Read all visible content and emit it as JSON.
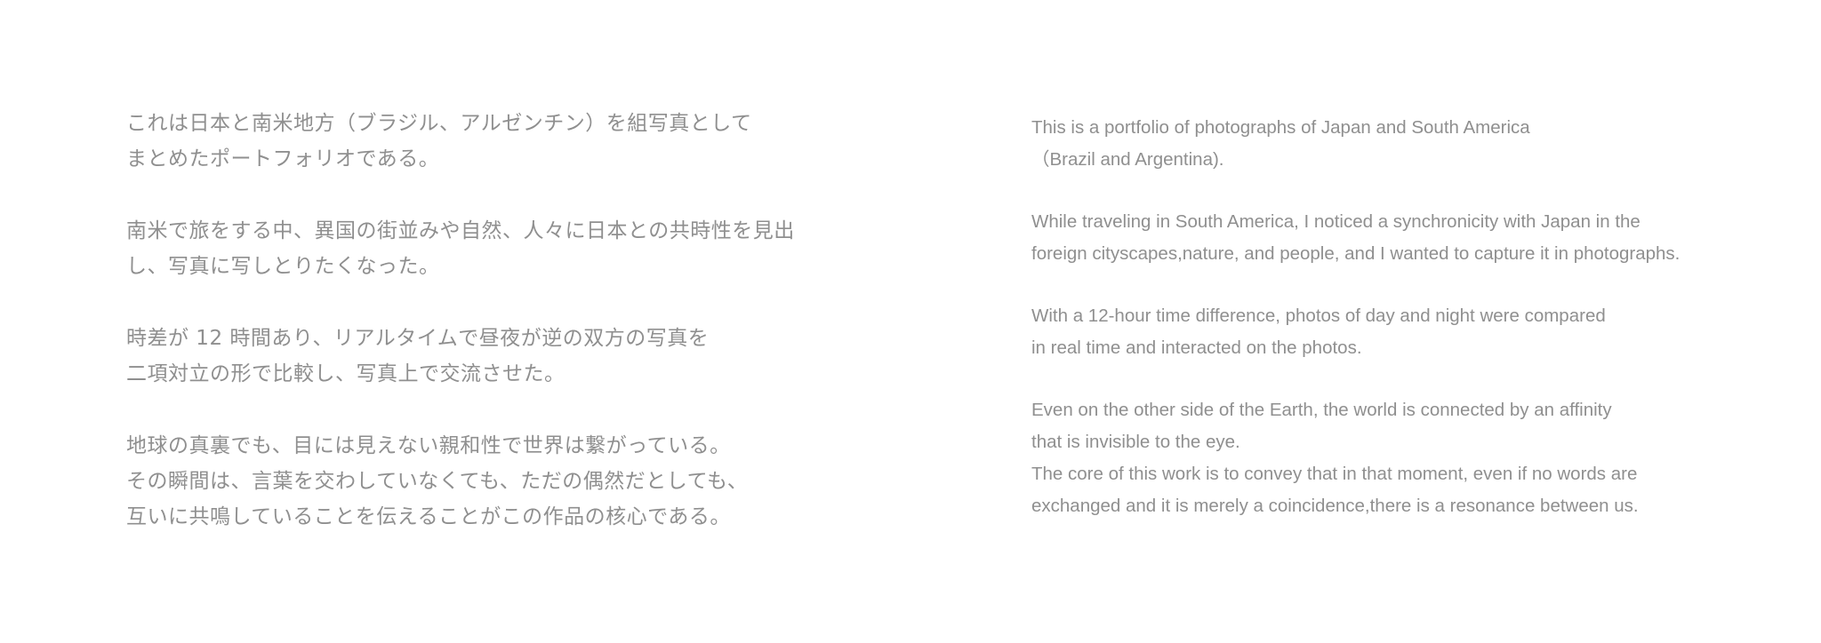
{
  "japanese": {
    "paragraphs": [
      {
        "lines": [
          "これは日本と南米地方（ブラジル、アルゼンチン）を組写真として",
          "まとめたポートフォリオである。"
        ]
      },
      {
        "lines": [
          "南米で旅をする中、異国の街並みや自然、人々に日本との共時性を見出",
          "し、写真に写しとりたくなった。"
        ]
      },
      {
        "lines": [
          "時差が 12 時間あり、リアルタイムで昼夜が逆の双方の写真を",
          "二項対立の形で比較し、写真上で交流させた。"
        ]
      },
      {
        "lines": [
          "地球の真裏でも、目には見えない親和性で世界は繋がっている。",
          "その瞬間は、言葉を交わしていなくても、ただの偶然だとしても、",
          "互いに共鳴していることを伝えることがこの作品の核心である。"
        ]
      }
    ]
  },
  "english": {
    "paragraphs": [
      {
        "lines": [
          "This is a portfolio of photographs of Japan and South America",
          "（Brazil and Argentina)."
        ]
      },
      {
        "lines": [
          "While traveling in South America, I noticed a synchronicity with Japan in the",
          "foreign cityscapes,nature, and people, and I wanted to capture it in photographs."
        ]
      },
      {
        "lines": [
          "With a 12-hour time difference, photos of day and night were compared",
          "in real time and interacted on the photos."
        ]
      },
      {
        "lines": [
          "Even on the other side of the Earth, the world is connected by an affinity",
          "that is invisible to the eye.",
          "The core of this work is to convey that in that moment, even if no words are",
          "exchanged and it is merely a coincidence,there is a resonance between us."
        ]
      }
    ]
  },
  "colors": {
    "text": "#8f8f8f",
    "background": "#ffffff"
  }
}
